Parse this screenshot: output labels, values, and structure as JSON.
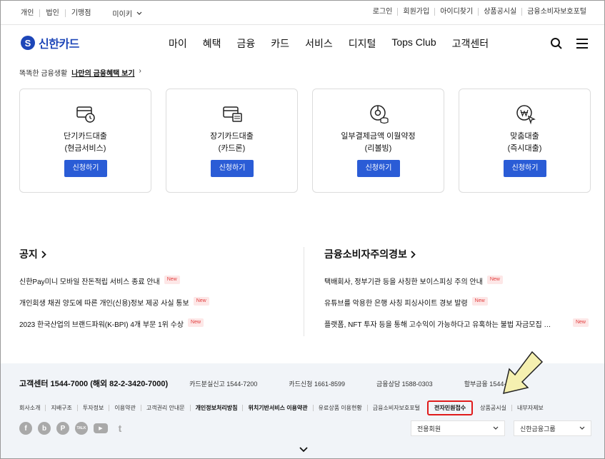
{
  "util": {
    "segments": [
      "개인",
      "법인",
      "기맹점"
    ],
    "language": "미이키",
    "right_links": [
      "로그인",
      "회원가입",
      "아이디찾기",
      "상품공시실",
      "금융소비자보호포털"
    ]
  },
  "header": {
    "logo_mark": "S",
    "logo_text": "신한카드",
    "nav": [
      "마이",
      "혜택",
      "금융",
      "카드",
      "서비스",
      "디지털",
      "Tops Club",
      "고객센터"
    ]
  },
  "promo": {
    "text": "똑똑한 금융생활",
    "link": "나만의 금융혜택 보기",
    "chevron": "›"
  },
  "cards": [
    {
      "icon": "card-clock-icon",
      "line1": "단기카드대출",
      "line2": "(현금서비스)",
      "button": "신청하기"
    },
    {
      "icon": "card-calendar-icon",
      "line1": "장기카드대출",
      "line2": "(카드론)",
      "button": "신청하기"
    },
    {
      "icon": "revolving-coins-icon",
      "line1": "일부결제금액 이월약정",
      "line2": "(리볼빙)",
      "button": "신청하기"
    },
    {
      "icon": "won-cursor-icon",
      "line1": "맞춤대출",
      "line2": "(즉시대출)",
      "button": "신청하기"
    }
  ],
  "notice": {
    "title": "공지",
    "items": [
      {
        "text": "신한Pay미니 모바일 잔돈적립 서비스 종료 안내",
        "badge": "New"
      },
      {
        "text": "개인회생 채권 양도에 따른 개인(신용)정보 제공 사실 통보",
        "badge": "New"
      },
      {
        "text": "2023 한국산업의 브랜드파워(K-BPI) 4개 부문 1위 수상",
        "badge": "New"
      }
    ]
  },
  "warning": {
    "title": "금융소비자주의경보",
    "items": [
      {
        "text": "택배회사, 정부기관 등을 사칭한 보이스피싱 주의 안내",
        "badge": "New"
      },
      {
        "text": "유튜브를 악용한 은행 사칭 피싱사이트 경보 발령",
        "badge": "New"
      },
      {
        "text": "플랫폼, NFT 투자 등을 통해 고수익이 가능하다고 유혹하는 불법 자금모집 …",
        "badge": "New"
      }
    ]
  },
  "footer": {
    "main_phone": "고객센터 1544-7000 (해외 82-2-3420-7000)",
    "phones": [
      "카드분실신고 1544-7200",
      "카드신청 1661-8599",
      "금융상담 1588-0303",
      "할부금융 1544-7100"
    ],
    "links": [
      {
        "label": "회사소개",
        "bold": false,
        "hl": false
      },
      {
        "label": "지배구조",
        "bold": false,
        "hl": false
      },
      {
        "label": "투자정보",
        "bold": false,
        "hl": false
      },
      {
        "label": "이용약관",
        "bold": false,
        "hl": false
      },
      {
        "label": "고객권리 안내문",
        "bold": false,
        "hl": false
      },
      {
        "label": "개인정보처리방침",
        "bold": true,
        "hl": false
      },
      {
        "label": "위치기반서비스 이용약관",
        "bold": true,
        "hl": false
      },
      {
        "label": "유료상품 이용현황",
        "bold": false,
        "hl": false
      },
      {
        "label": "금융소비자보호포털",
        "bold": false,
        "hl": false
      },
      {
        "label": "전자민원접수",
        "bold": true,
        "hl": true
      },
      {
        "label": "상품공시실",
        "bold": false,
        "hl": false
      },
      {
        "label": "내부자제보",
        "bold": false,
        "hl": false
      }
    ],
    "sns": [
      {
        "name": "facebook-icon",
        "glyph": "f"
      },
      {
        "name": "blog-icon",
        "glyph": "b"
      },
      {
        "name": "post-icon",
        "glyph": "P"
      },
      {
        "name": "kakaotalk-icon",
        "glyph": "TALK"
      },
      {
        "name": "youtube-icon",
        "glyph": "▶"
      },
      {
        "name": "twitter-icon",
        "glyph": "t"
      }
    ],
    "select1": "전용회원",
    "select2": "신한금융그룹"
  },
  "colors": {
    "brand": "#1d46b8",
    "button": "#2a5cd6",
    "highlight": "#e01b1b",
    "arrow": "#f5f0b0"
  }
}
